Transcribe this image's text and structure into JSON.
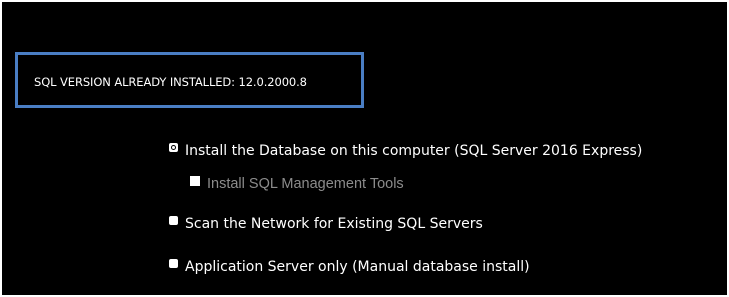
{
  "version_notice": {
    "text": "SQL VERSION ALREADY INSTALLED: 12.0.2000.8"
  },
  "options": [
    {
      "label": "Install the Database on this computer (SQL Server 2016 Express)",
      "selected": true
    },
    {
      "label": "Scan the Network for Existing SQL Servers",
      "selected": false
    },
    {
      "label": "Application Server only (Manual database install)",
      "selected": false
    }
  ],
  "sub_options": [
    {
      "label": "Install SQL Management Tools",
      "checked": false,
      "enabled": false
    }
  ],
  "colors": {
    "background": "#000000",
    "highlight_border": "#4a7ec4",
    "text": "#ffffff",
    "disabled_text": "#8c8c8c"
  }
}
